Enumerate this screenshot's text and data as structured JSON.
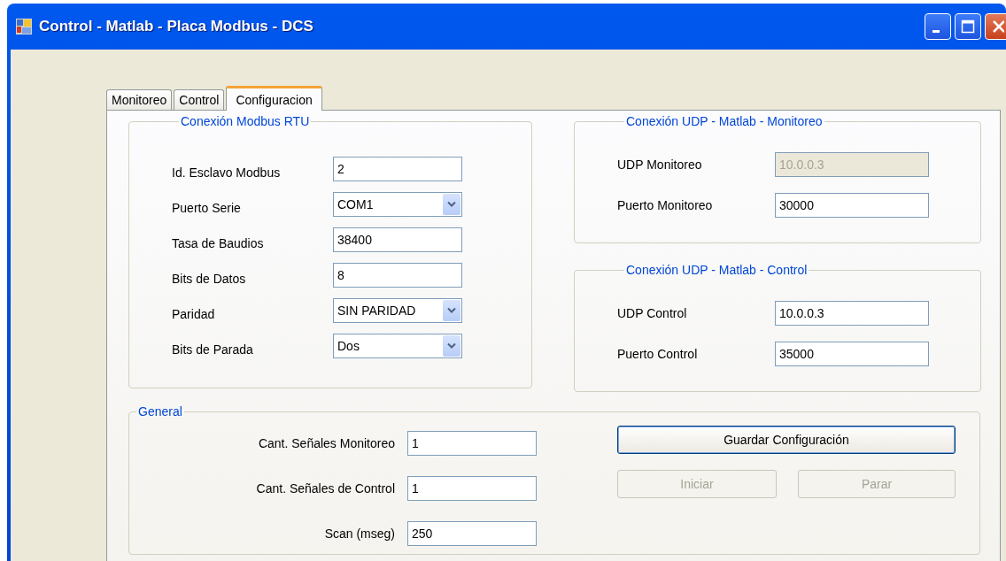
{
  "window": {
    "title": "Control - Matlab - Placa Modbus - DCS"
  },
  "tabs": [
    {
      "label": "Monitoreo",
      "selected": false
    },
    {
      "label": "Control",
      "selected": false
    },
    {
      "label": "Configuracion",
      "selected": true
    }
  ],
  "modbus": {
    "title": "Conexión Modbus RTU",
    "fields": [
      {
        "label": "Id. Esclavo Modbus",
        "kind": "text",
        "value": "2",
        "disabled": false
      },
      {
        "label": "Puerto Serie",
        "kind": "combo",
        "value": "COM1",
        "disabled": false
      },
      {
        "label": "Tasa de  Baudios",
        "kind": "text",
        "value": "38400",
        "disabled": false
      },
      {
        "label": "Bits de Datos",
        "kind": "text",
        "value": "8",
        "disabled": false
      },
      {
        "label": "Paridad",
        "kind": "combo",
        "value": "SIN PARIDAD",
        "disabled": false
      },
      {
        "label": "Bits de Parada",
        "kind": "combo",
        "value": "Dos",
        "disabled": false
      }
    ]
  },
  "udp_groups": [
    {
      "title": "Conexión UDP - Matlab - Monitoreo",
      "fields": [
        {
          "label": "UDP Monitoreo",
          "value": "10.0.0.3",
          "disabled": true
        },
        {
          "label": "Puerto Monitoreo",
          "value": "30000",
          "disabled": false
        }
      ]
    },
    {
      "title": "Conexión UDP - Matlab - Control",
      "fields": [
        {
          "label": "UDP Control",
          "value": "10.0.0.3",
          "disabled": false
        },
        {
          "label": "Puerto Control",
          "value": "35000",
          "disabled": false
        }
      ]
    }
  ],
  "general": {
    "title": "General",
    "fields": [
      {
        "label": "Cant. Señales Monitoreo",
        "value": "1",
        "disabled": false
      },
      {
        "label": "Cant. Señales de Control",
        "value": "1",
        "disabled": false
      },
      {
        "label": "Scan (mseg)",
        "value": "250",
        "disabled": false
      }
    ],
    "buttons": [
      {
        "label": "Guardar Configuración",
        "disabled": false,
        "focused": true
      },
      {
        "label": "Iniciar",
        "disabled": true,
        "focused": false
      },
      {
        "label": "Parar",
        "disabled": true,
        "focused": false
      }
    ]
  }
}
